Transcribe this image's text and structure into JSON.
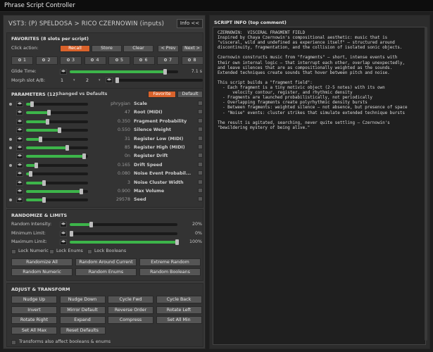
{
  "window": {
    "title": "Phrase Script Controller"
  },
  "header": {
    "vst_text": "VST3: (P) SPELDOSA  >  RICO CZERNOWIN (inputs)",
    "info_button": "Info <<"
  },
  "favorites": {
    "title": "FAVORITES (8 slots per script)",
    "click_action_label": "Click action:",
    "actions": [
      "Recall",
      "Store",
      "Clear"
    ],
    "prev": "< Prev",
    "next": "Next >",
    "slots": [
      "1",
      "2",
      "3",
      "4",
      "5",
      "6",
      "7",
      "8"
    ],
    "glide_label": "Glide Time:",
    "glide_value": "7.1 s",
    "glide_fraction": 0.88,
    "morph_label": "Morph slot A/B:",
    "morph_a": "1",
    "morph_b": "2"
  },
  "parameters": {
    "title": "PARAMETERS (12)",
    "subtitle": "changed vs Defaults",
    "favorite_button": "Favorite",
    "default_button": "Default",
    "items": [
      {
        "value": "phrygian",
        "name": "Scale",
        "fraction": 0.1,
        "dot": true
      },
      {
        "value": "47",
        "name": "Root (MIDI)",
        "fraction": 0.37,
        "dot": false
      },
      {
        "value": "0.350",
        "name": "Fragment Probability",
        "fraction": 0.35,
        "dot": false
      },
      {
        "value": "0.550",
        "name": "Silence Weight",
        "fraction": 0.55,
        "dot": false
      },
      {
        "value": "31",
        "name": "Register Low (MIDI)",
        "fraction": 0.24,
        "dot": true
      },
      {
        "value": "85",
        "name": "Register High (MIDI)",
        "fraction": 0.67,
        "dot": true
      },
      {
        "value": "0n",
        "name": "Register Drift",
        "fraction": 0.94,
        "dot": false
      },
      {
        "value": "0.165",
        "name": "Drift Speed",
        "fraction": 0.17,
        "dot": true
      },
      {
        "value": "0.080",
        "name": "Noise Event Probabil...",
        "fraction": 0.08,
        "dot": false
      },
      {
        "value": "3",
        "name": "Noise Cluster Width",
        "fraction": 0.3,
        "dot": false
      },
      {
        "value": "0.900",
        "name": "Max Volume",
        "fraction": 0.9,
        "dot": false
      },
      {
        "value": "29578",
        "name": "Seed",
        "fraction": 0.3,
        "dot": true
      }
    ]
  },
  "randomize": {
    "title": "RANDOMIZE & LIMITS",
    "sliders": [
      {
        "label": "Random Intensity:",
        "value": "20%",
        "fraction": 0.2
      },
      {
        "label": "Minimum Limit:",
        "value": "0%",
        "fraction": 0.0
      },
      {
        "label": "Maximum Limit:",
        "value": "100%",
        "fraction": 1.0
      }
    ],
    "locks": [
      "Lock Numeric",
      "Lock Enums",
      "Lock Booleans"
    ],
    "buttons": [
      "Randomize All",
      "Random Around Current",
      "Extreme Random",
      "Random Numeric",
      "Random Enums",
      "Random Booleans"
    ]
  },
  "adjust": {
    "title": "ADJUST & TRANSFORM",
    "buttons": [
      "Nudge Up",
      "Nudge Down",
      "Cycle Fwd",
      "Cycle Back",
      "Invert",
      "Mirror Default",
      "Reverse Order",
      "Rotate Left",
      "Rotate Right",
      "Expand",
      "Compress",
      "Set All Min",
      "Set All Max",
      "Reset Defaults"
    ],
    "checkbox_label": "Transforms also affect booleans & enums"
  },
  "script_info": {
    "title": "SCRIPT INFO (top comment)",
    "text": "CZERNOWIN:  VISCERAL FRAGMENT FIELD\nInspired by Chaya Czernowin's compositional aesthetic: music that is\n\"visceral, wild and undefined as experience itself\" – structured around\ndiscontinuity, fragmentation, and the collision of isolated sonic objects.\n\nCzernowin constructs music from \"fragments\" – short, intense events with\ntheir own internal logic – that interrupt each other, overlap unexpectedly,\nand leave silences that are as compositionally weighted as the sounds.\nExtended techniques create sounds that hover between pitch and noise.\n\nThis script builds a \"fragment field\":\n  - Each fragment is a tiny motivic object (2-5 notes) with its own\n      velocity contour, register, and rhythmic density\n  - Fragments are launched probabilistically, not periodically\n  - Overlapping fragments create polyrhythmic density bursts\n  - Between fragments: weighted silence – not absence, but presence of space\n  - \"Noise\" events: cluster strikes that simulate extended technique bursts\n\nThe result is agitated, searching, never quite settling – Czernowin's\n\"bewildering mystery of being alive.\""
  }
}
